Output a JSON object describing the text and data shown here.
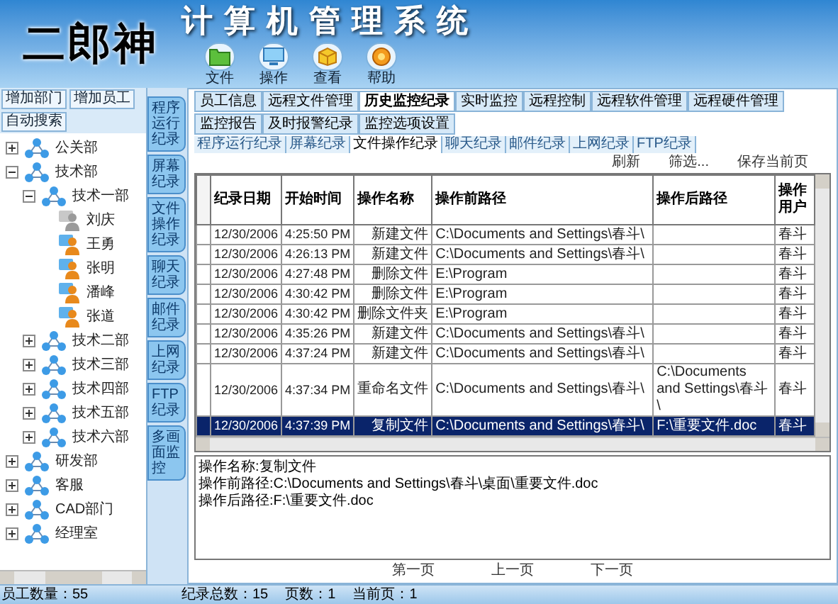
{
  "app": {
    "logo": "二郎神",
    "title": "计算机管理系统"
  },
  "toolbar": [
    {
      "label": "文件",
      "kind": "file"
    },
    {
      "label": "操作",
      "kind": "operate"
    },
    {
      "label": "查看",
      "kind": "view"
    },
    {
      "label": "帮助",
      "kind": "help"
    }
  ],
  "sidebar": {
    "buttons": [
      "增加部门",
      "增加员工",
      "自动搜索"
    ],
    "tree": [
      {
        "label": "公关部",
        "kind": "department",
        "expanded": false
      },
      {
        "label": "技术部",
        "kind": "department",
        "expanded": true,
        "children": [
          {
            "label": "技术一部",
            "kind": "department",
            "expanded": true,
            "children": [
              {
                "label": "刘庆",
                "kind": "person",
                "online": false
              },
              {
                "label": "王勇",
                "kind": "person",
                "online": true
              },
              {
                "label": "张明",
                "kind": "person",
                "online": true
              },
              {
                "label": "潘峰",
                "kind": "person",
                "online": true
              },
              {
                "label": "张道",
                "kind": "person",
                "online": true
              }
            ]
          },
          {
            "label": "技术二部",
            "kind": "department",
            "expanded": false
          },
          {
            "label": "技术三部",
            "kind": "department",
            "expanded": false
          },
          {
            "label": "技术四部",
            "kind": "department",
            "expanded": false
          },
          {
            "label": "技术五部",
            "kind": "department",
            "expanded": false
          },
          {
            "label": "技术六部",
            "kind": "department",
            "expanded": false
          }
        ]
      },
      {
        "label": "研发部",
        "kind": "department",
        "expanded": false
      },
      {
        "label": "客服",
        "kind": "department",
        "expanded": false
      },
      {
        "label": "CAD部门",
        "kind": "department",
        "expanded": false
      },
      {
        "label": "经理室",
        "kind": "department",
        "expanded": false
      }
    ]
  },
  "side_tabs": [
    "程序运行纪录",
    "屏幕纪录",
    "文件操作纪录",
    "聊天纪录",
    "邮件纪录",
    "上网纪录",
    "FTP纪录",
    "多画面监控"
  ],
  "tabs": [
    {
      "label": "员工信息",
      "selected": false
    },
    {
      "label": "远程文件管理",
      "selected": false
    },
    {
      "label": "历史监控纪录",
      "selected": true
    },
    {
      "label": "实时监控",
      "selected": false
    },
    {
      "label": "远程控制",
      "selected": false
    },
    {
      "label": "远程软件管理",
      "selected": false
    },
    {
      "label": "远程硬件管理",
      "selected": false
    },
    {
      "label": "监控报告",
      "selected": false
    },
    {
      "label": "及时报警纪录",
      "selected": false
    },
    {
      "label": "监控选项设置",
      "selected": false
    }
  ],
  "subtabs": [
    {
      "label": "程序运行纪录",
      "selected": false
    },
    {
      "label": "屏幕纪录",
      "selected": false
    },
    {
      "label": "文件操作纪录",
      "selected": true
    },
    {
      "label": "聊天纪录",
      "selected": false
    },
    {
      "label": "邮件纪录",
      "selected": false
    },
    {
      "label": "上网纪录",
      "selected": false
    },
    {
      "label": "FTP纪录",
      "selected": false
    }
  ],
  "actions": [
    "刷新",
    "筛选...",
    "保存当前页"
  ],
  "table": {
    "columns": [
      "纪录日期",
      "开始时间",
      "操作名称",
      "操作前路径",
      "操作后路径",
      "操作用户"
    ],
    "rows": [
      {
        "cells": [
          "12/30/2006",
          "4:25:50 PM",
          "新建文件",
          "C:\\Documents and Settings\\春斗\\",
          "",
          "春斗"
        ],
        "selected": false
      },
      {
        "cells": [
          "12/30/2006",
          "4:26:13 PM",
          "新建文件",
          "C:\\Documents and Settings\\春斗\\",
          "",
          "春斗"
        ],
        "selected": false
      },
      {
        "cells": [
          "12/30/2006",
          "4:27:48 PM",
          "删除文件",
          "E:\\Program",
          "",
          "春斗"
        ],
        "selected": false
      },
      {
        "cells": [
          "12/30/2006",
          "4:30:42 PM",
          "删除文件",
          "E:\\Program",
          "",
          "春斗"
        ],
        "selected": false
      },
      {
        "cells": [
          "12/30/2006",
          "4:30:42 PM",
          "删除文件夹",
          "E:\\Program",
          "",
          "春斗"
        ],
        "selected": false
      },
      {
        "cells": [
          "12/30/2006",
          "4:35:26 PM",
          "新建文件",
          "C:\\Documents and Settings\\春斗\\",
          "",
          "春斗"
        ],
        "selected": false
      },
      {
        "cells": [
          "12/30/2006",
          "4:37:24 PM",
          "新建文件",
          "C:\\Documents and Settings\\春斗\\",
          "",
          "春斗"
        ],
        "selected": false
      },
      {
        "cells": [
          "12/30/2006",
          "4:37:34 PM",
          "重命名文件",
          "C:\\Documents and Settings\\春斗\\",
          "C:\\Documents and Settings\\春斗\\",
          "春斗"
        ],
        "selected": false
      },
      {
        "cells": [
          "12/30/2006",
          "4:37:39 PM",
          "复制文件",
          "C:\\Documents and Settings\\春斗\\",
          "F:\\重要文件.doc",
          "春斗"
        ],
        "selected": true
      }
    ]
  },
  "detail": [
    "操作名称:复制文件",
    "操作前路径:C:\\Documents and Settings\\春斗\\桌面\\重要文件.doc",
    "操作后路径:F:\\重要文件.doc"
  ],
  "pager": [
    "第一页",
    "上一页",
    "下一页"
  ],
  "status_bar": {
    "employees": "员工数量：55",
    "items": [
      "纪录总数：15",
      "页数：1",
      "当前页：1"
    ]
  }
}
